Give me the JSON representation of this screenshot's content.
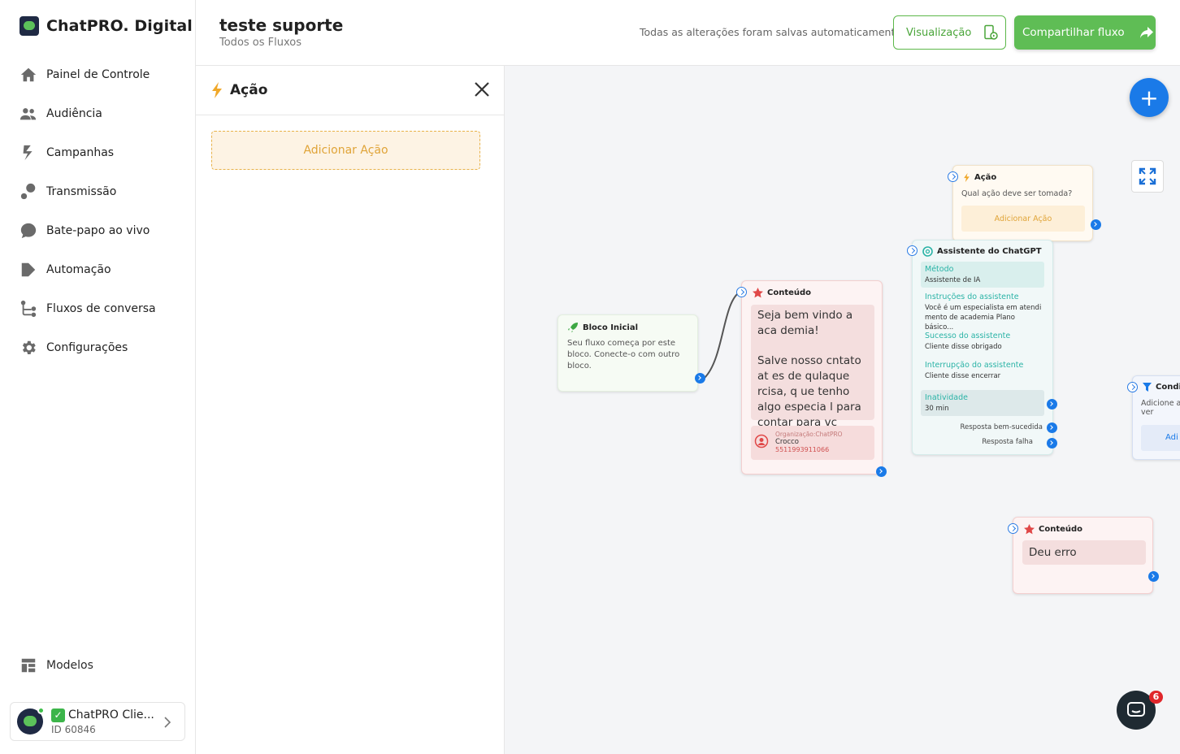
{
  "brand": {
    "name": "ChatPRO. Digital"
  },
  "sidebar": {
    "items": [
      {
        "label": "Painel de Controle",
        "icon": "home-icon"
      },
      {
        "label": "Audiência",
        "icon": "users-icon"
      },
      {
        "label": "Campanhas",
        "icon": "campaign-icon"
      },
      {
        "label": "Transmissão",
        "icon": "broadcast-icon"
      },
      {
        "label": "Bate-papo ao vivo",
        "icon": "chat-icon"
      },
      {
        "label": "Automação",
        "icon": "automation-icon"
      },
      {
        "label": "Fluxos de conversa",
        "icon": "flow-icon"
      },
      {
        "label": "Configurações",
        "icon": "gear-icon"
      }
    ],
    "models_label": "Modelos",
    "account": {
      "check": "✓",
      "name": "ChatPRO Clie...",
      "id": "ID 60846"
    }
  },
  "header": {
    "title": "teste suporte",
    "breadcrumb": "Todos os Fluxos",
    "saved_status": "Todas as alterações foram salvas automaticamente",
    "preview_label": "Visualização",
    "share_label": "Compartilhar fluxo"
  },
  "panel": {
    "title": "Ação",
    "add_action_label": "Adicionar Ação"
  },
  "canvas": {
    "fab_label": "+",
    "start_block": {
      "title": "Bloco Inicial",
      "text": "Seu fluxo começa por este bloco. Conecte-o com outro bloco."
    },
    "content_block_1": {
      "title": "Conteúdo",
      "message_1": "Seja bem vindo a aca demia!",
      "message_2": "Salve nosso cntato at es de qulaque rcisa, q ue tenho algo especia l para contar para vc",
      "contact_org": "Organização:ChatPRO",
      "contact_name": "Crocco",
      "contact_phone": "5511993911066"
    },
    "action_block": {
      "title": "Ação",
      "question": "Qual ação deve ser tomada?",
      "add_label": "Adicionar Ação"
    },
    "gpt_block": {
      "title": "Assistente do ChatGPT",
      "method_label": "Método",
      "method_value": "Assistente de IA",
      "instructions_label": "Instruções do assistente",
      "instructions_value": "Você é um especialista em atendi mento de academia Plano básico...",
      "success_label": "Sucesso do assistente",
      "success_value": "Cliente disse obrigado",
      "interrupt_label": "Interrupção do assistente",
      "interrupt_value": "Cliente disse encerrar",
      "inactivity_label": "Inatividade",
      "inactivity_value": "30 min",
      "response_success": "Resposta bem-sucedida",
      "response_fail": "Resposta falha"
    },
    "condition_block": {
      "title": "Condi",
      "text": "Adicione a ver",
      "button": "Adi"
    },
    "content_block_2": {
      "title": "Conteúdo",
      "message": "Deu erro"
    }
  },
  "chat_widget": {
    "badge": "6"
  },
  "colors": {
    "accent_green": "#5fbd55",
    "accent_blue": "#1a7ae8",
    "action_orange": "#e0a438",
    "gpt_teal": "#2ab3a6",
    "content_red": "#e04848"
  }
}
